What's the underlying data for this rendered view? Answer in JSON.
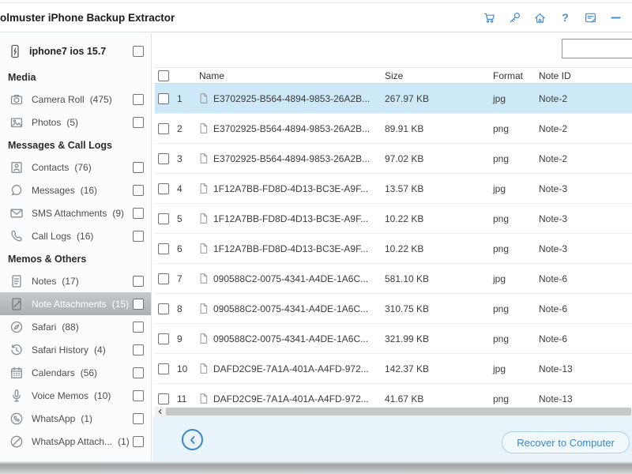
{
  "colors": {
    "accent": "#4a8fc7",
    "row_highlight": "#cde8f6",
    "selected_sidebar_item_bg": "#b2b6b9",
    "footer_bg": "#e9f3fa"
  },
  "header": {
    "title": "olmuster iPhone Backup Extractor",
    "toolbar_icons": [
      "cart",
      "key",
      "home",
      "help",
      "feedback",
      "minimize"
    ]
  },
  "search": {
    "value": "",
    "placeholder": ""
  },
  "sidebar": {
    "device": {
      "label": "iphone7 ios 15.7"
    },
    "sections": [
      {
        "header": "Media",
        "items": [
          {
            "icon": "camera",
            "label": "Camera Roll",
            "count": "(475)",
            "selected": false
          },
          {
            "icon": "photos",
            "label": "Photos",
            "count": "(5)",
            "selected": false
          }
        ]
      },
      {
        "header": "Messages & Call Logs",
        "items": [
          {
            "icon": "contacts",
            "label": "Contacts",
            "count": "(76)",
            "selected": false
          },
          {
            "icon": "messages",
            "label": "Messages",
            "count": "(16)",
            "selected": false
          },
          {
            "icon": "sms-attachments",
            "label": "SMS Attachments",
            "count": "(9)",
            "selected": false
          },
          {
            "icon": "call-logs",
            "label": "Call Logs",
            "count": "(16)",
            "selected": false
          }
        ]
      },
      {
        "header": "Memos & Others",
        "items": [
          {
            "icon": "notes",
            "label": "Notes",
            "count": "(17)",
            "selected": false
          },
          {
            "icon": "note-attachments",
            "label": "Note Attachments",
            "count": "(15)",
            "selected": true
          },
          {
            "icon": "safari",
            "label": "Safari",
            "count": "(88)",
            "selected": false
          },
          {
            "icon": "safari-history",
            "label": "Safari History",
            "count": "(4)",
            "selected": false
          },
          {
            "icon": "calendars",
            "label": "Calendars",
            "count": "(56)",
            "selected": false
          },
          {
            "icon": "voice-memos",
            "label": "Voice Memos",
            "count": "(10)",
            "selected": false
          },
          {
            "icon": "whatsapp",
            "label": "WhatsApp",
            "count": "(1)",
            "selected": false
          },
          {
            "icon": "whatsapp-attachments",
            "label": "WhatsApp Attach...",
            "count": "(1)",
            "selected": false
          }
        ]
      }
    ]
  },
  "table": {
    "columns": [
      "Name",
      "Size",
      "Format",
      "Note ID"
    ],
    "rows": [
      {
        "num": "1",
        "name": "E3702925-B564-4894-9853-26A2B...",
        "size": "267.97 KB",
        "format": "jpg",
        "note_id": "Note-2",
        "selected": true
      },
      {
        "num": "2",
        "name": "E3702925-B564-4894-9853-26A2B...",
        "size": "89.91 KB",
        "format": "png",
        "note_id": "Note-2",
        "selected": false
      },
      {
        "num": "3",
        "name": "E3702925-B564-4894-9853-26A2B...",
        "size": "97.02 KB",
        "format": "png",
        "note_id": "Note-2",
        "selected": false
      },
      {
        "num": "4",
        "name": "1F12A7BB-FD8D-4D13-BC3E-A9F...",
        "size": "13.57 KB",
        "format": "jpg",
        "note_id": "Note-3",
        "selected": false
      },
      {
        "num": "5",
        "name": "1F12A7BB-FD8D-4D13-BC3E-A9F...",
        "size": "10.22 KB",
        "format": "png",
        "note_id": "Note-3",
        "selected": false
      },
      {
        "num": "6",
        "name": "1F12A7BB-FD8D-4D13-BC3E-A9F...",
        "size": "10.22 KB",
        "format": "png",
        "note_id": "Note-3",
        "selected": false
      },
      {
        "num": "7",
        "name": "090588C2-0075-4341-A4DE-1A6C...",
        "size": "581.10 KB",
        "format": "jpg",
        "note_id": "Note-6",
        "selected": false
      },
      {
        "num": "8",
        "name": "090588C2-0075-4341-A4DE-1A6C...",
        "size": "310.75 KB",
        "format": "png",
        "note_id": "Note-6",
        "selected": false
      },
      {
        "num": "9",
        "name": "090588C2-0075-4341-A4DE-1A6C...",
        "size": "321.99 KB",
        "format": "png",
        "note_id": "Note-6",
        "selected": false
      },
      {
        "num": "10",
        "name": "DAFD2C9E-7A1A-401A-A4FD-972...",
        "size": "142.37 KB",
        "format": "jpg",
        "note_id": "Note-13",
        "selected": false
      },
      {
        "num": "11",
        "name": "DAFD2C9E-7A1A-401A-A4FD-972...",
        "size": "41.67 KB",
        "format": "png",
        "note_id": "Note-13",
        "selected": false
      }
    ]
  },
  "footer": {
    "recover_label": "Recover to Computer"
  }
}
